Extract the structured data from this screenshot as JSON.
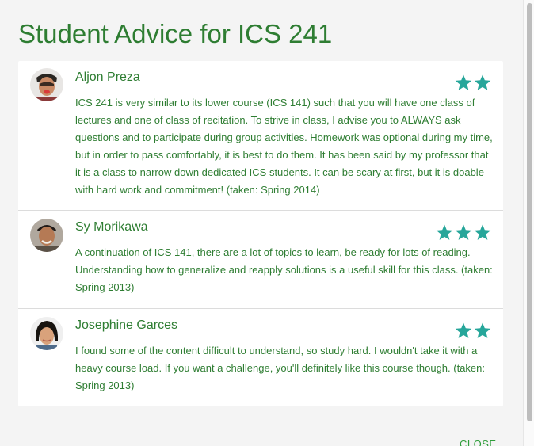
{
  "modal": {
    "title": "Student Advice for ICS 241",
    "close_label": "CLOSE"
  },
  "colors": {
    "title": "#2e7d32",
    "star": "#26a69a",
    "card": "#ffffff"
  },
  "reviews": [
    {
      "name": "Aljon Preza",
      "rating": 2,
      "text": "ICS 241 is very similar to its lower course (ICS 141) such that you will have one class of lectures and one of class of recitation. To strive in class, I advise you to ALWAYS ask questions and to participate during group activities. Homework was optional during my time, but in order to pass comfortably, it is best to do them. It has been said by my professor that it is a class to narrow down dedicated ICS students. It can be scary at first, but it is doable with hard work and commitment! (taken: Spring 2014)"
    },
    {
      "name": "Sy Morikawa",
      "rating": 3,
      "text": "A continuation of ICS 141, there are a lot of topics to learn, be ready for lots of reading. Understanding how to generalize and reapply solutions is a useful skill for this class. (taken: Spring 2013)"
    },
    {
      "name": "Josephine Garces",
      "rating": 2,
      "text": "I found some of the content difficult to understand, so study hard. I wouldn't take it with a heavy course load. If you want a challenge, you'll definitely like this course though. (taken: Spring 2013)"
    }
  ]
}
